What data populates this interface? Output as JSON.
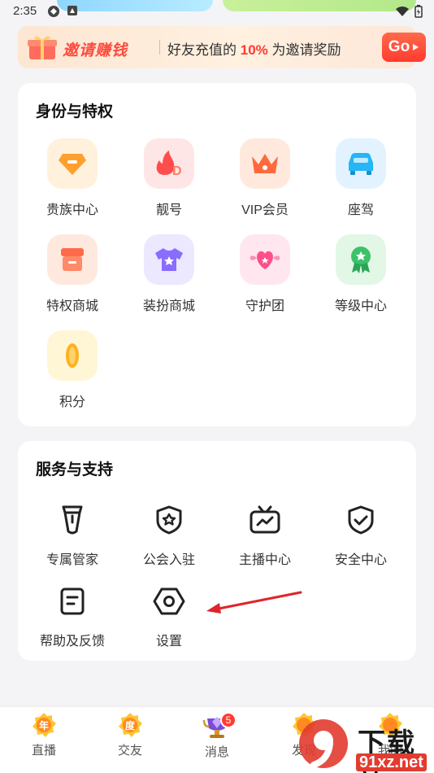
{
  "status": {
    "time": "2:35"
  },
  "banner": {
    "invite_label": "邀请赚钱",
    "text_prefix": "好友充值的 ",
    "text_highlight": "10%",
    "text_suffix": " 为邀请奖励",
    "go_label": "Go"
  },
  "privileges": {
    "title": "身份与特权",
    "items": [
      {
        "label": "贵族中心",
        "icon": "noble-gem-icon",
        "bg": "#fff1dc",
        "color": "#ff9a2e"
      },
      {
        "label": "靓号",
        "icon": "fire-d-icon",
        "bg": "#ffe6e6",
        "color": "#ff4d4d"
      },
      {
        "label": "VIP会员",
        "icon": "crown-icon",
        "bg": "#ffe9dd",
        "color": "#ff6a3d"
      },
      {
        "label": "座驾",
        "icon": "car-icon",
        "bg": "#e2f3ff",
        "color": "#25b6f5"
      },
      {
        "label": "特权商城",
        "icon": "shop-icon",
        "bg": "#ffe9df",
        "color": "#ff6a4a"
      },
      {
        "label": "装扮商城",
        "icon": "shirt-icon",
        "bg": "#ebe8ff",
        "color": "#8a6cff"
      },
      {
        "label": "守护团",
        "icon": "heart-wings-icon",
        "bg": "#ffe6ef",
        "color": "#ff4f8b"
      },
      {
        "label": "等级中心",
        "icon": "medal-icon",
        "bg": "#e2f7e6",
        "color": "#3cc26a"
      },
      {
        "label": "积分",
        "icon": "coin-icon",
        "bg": "#fff6d6",
        "color": "#ffb020"
      }
    ]
  },
  "services": {
    "title": "服务与支持",
    "items": [
      {
        "label": "专属管家",
        "icon": "butler-tie-icon"
      },
      {
        "label": "公会入驻",
        "icon": "guild-shield-star-icon"
      },
      {
        "label": "主播中心",
        "icon": "tv-chart-icon"
      },
      {
        "label": "安全中心",
        "icon": "security-shield-check-icon"
      },
      {
        "label": "帮助及反馈",
        "icon": "help-document-icon"
      },
      {
        "label": "设置",
        "icon": "settings-hexagon-icon"
      }
    ]
  },
  "tabbar": {
    "tabs": [
      {
        "label": "直播",
        "icon": "live-nian-icon"
      },
      {
        "label": "交友",
        "icon": "friends-du-icon"
      },
      {
        "label": "消息",
        "icon": "message-trophy-icon",
        "badge": "5"
      },
      {
        "label": "发现",
        "icon": "discover-icon"
      },
      {
        "label": "我的",
        "icon": "mine-icon"
      }
    ]
  },
  "watermark": {
    "line1": "下载站",
    "line2": "91xz.net"
  },
  "colors": {
    "accent": "#ff3b30",
    "annotation": "#e0242b"
  }
}
